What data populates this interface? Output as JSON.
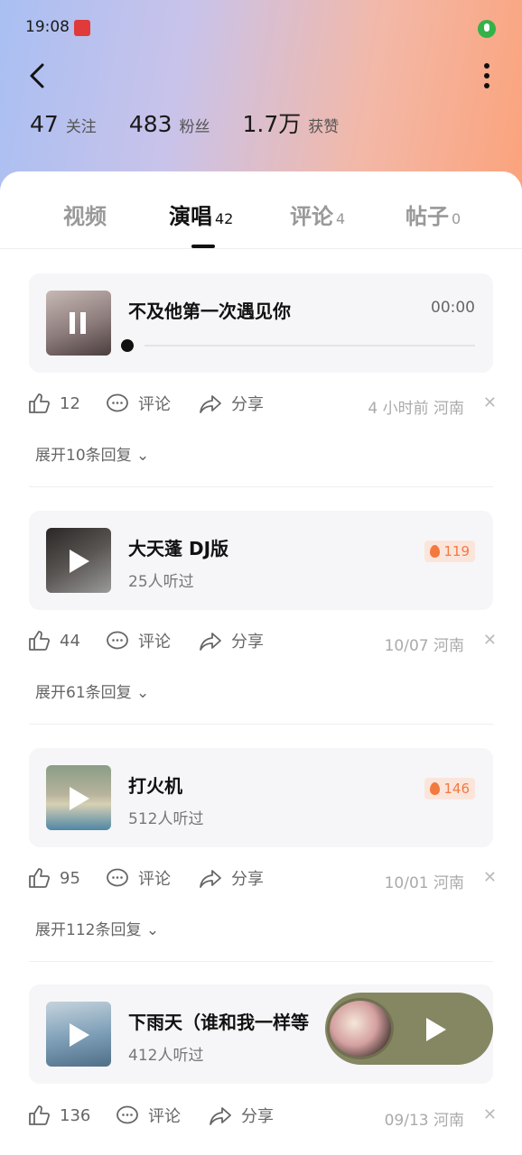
{
  "status": {
    "time": "19:08",
    "badge": "IMG"
  },
  "profile": {
    "stats": [
      {
        "value": "47",
        "label": "关注"
      },
      {
        "value": "483",
        "label": "粉丝"
      },
      {
        "value": "1.7万",
        "label": "获赞"
      }
    ]
  },
  "tabs": [
    {
      "label": "视频",
      "count": ""
    },
    {
      "label": "演唱",
      "count": "42"
    },
    {
      "label": "评论",
      "count": "4"
    },
    {
      "label": "帖子",
      "count": "0"
    }
  ],
  "posts": [
    {
      "title": "不及他第一次遇见你",
      "duration": "00:00",
      "listeners": "",
      "heat": "",
      "playing": true,
      "likes": "12",
      "comment_label": "评论",
      "share_label": "分享",
      "meta": "4 小时前 河南",
      "expand": "展开10条回复",
      "colors": [
        "#c7b9b6",
        "#4b3d3e"
      ]
    },
    {
      "title": "大天蓬 DJ版",
      "duration": "",
      "listeners": "25人听过",
      "heat": "119",
      "playing": false,
      "likes": "44",
      "comment_label": "评论",
      "share_label": "分享",
      "meta": "10/07 河南",
      "expand": "展开61条回复",
      "colors": [
        "#2a2625",
        "#9a9a9a"
      ]
    },
    {
      "title": "打火机",
      "duration": "",
      "listeners": "512人听过",
      "heat": "146",
      "playing": false,
      "likes": "95",
      "comment_label": "评论",
      "share_label": "分享",
      "meta": "10/01 河南",
      "expand": "展开112条回复",
      "colors": [
        "#8a9d86",
        "#d6d0b3"
      ]
    },
    {
      "title": "下雨天（谁和我一样等",
      "duration": "",
      "listeners": "412人听过",
      "heat": "",
      "playing": false,
      "likes": "136",
      "comment_label": "评论",
      "share_label": "分享",
      "meta": "09/13 河南",
      "expand": "",
      "colors": [
        "#7c9db6",
        "#c5d4dd"
      ]
    }
  ]
}
